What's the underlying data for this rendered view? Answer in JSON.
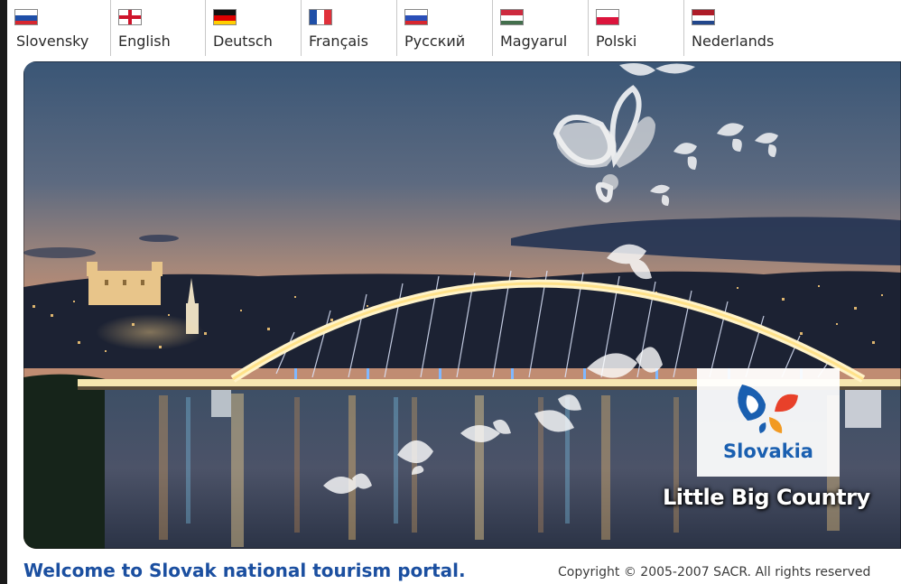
{
  "languages": [
    {
      "label": "Slovensky",
      "flag": "slovak-flag-icon"
    },
    {
      "label": "English",
      "flag": "english-flag-icon"
    },
    {
      "label": "Deutsch",
      "flag": "german-flag-icon"
    },
    {
      "label": "Français",
      "flag": "french-flag-icon"
    },
    {
      "label": "Русский",
      "flag": "russian-flag-icon"
    },
    {
      "label": "Magyarul",
      "flag": "hungarian-flag-icon"
    },
    {
      "label": "Polski",
      "flag": "polish-flag-icon"
    },
    {
      "label": "Nederlands",
      "flag": "dutch-flag-icon"
    }
  ],
  "hero": {
    "logo_text": "Slovakia",
    "slogan": "Little Big Country"
  },
  "footer": {
    "welcome": "Welcome to Slovak national tourism portal.",
    "copyright": "Copyright © 2005-2007 SACR. All rights reserved"
  },
  "colors": {
    "brand_blue": "#1b4fa0",
    "logo_red": "#e8412a",
    "logo_orange": "#f29a22"
  }
}
